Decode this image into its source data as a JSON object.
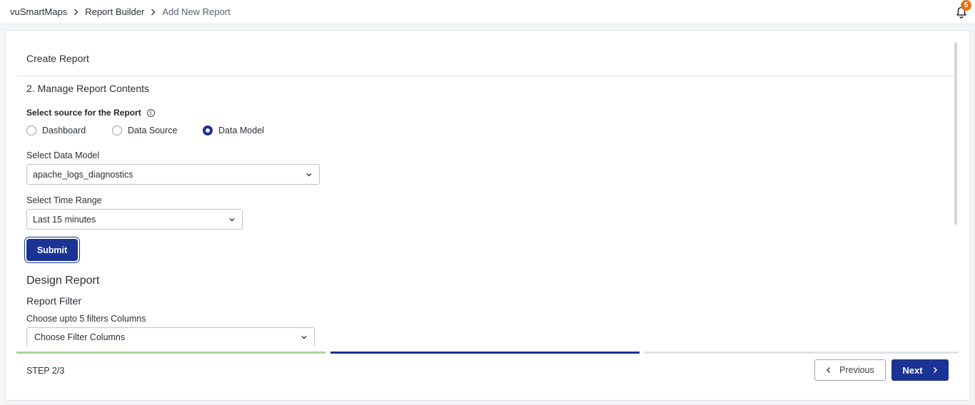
{
  "breadcrumb": {
    "items": [
      "vuSmartMaps",
      "Report Builder",
      "Add New Report"
    ]
  },
  "notifications": {
    "count": "5"
  },
  "header": {
    "title": "Create Report"
  },
  "step": {
    "title": "2. Manage Report Contents",
    "source_label": "Select source for the Report",
    "info_icon": "i",
    "sources": [
      {
        "label": "Dashboard",
        "selected": false
      },
      {
        "label": "Data Source",
        "selected": false
      },
      {
        "label": "Data Model",
        "selected": true
      }
    ]
  },
  "data_model": {
    "label": "Select Data Model",
    "value": "apache_logs_diagnostics"
  },
  "time_range": {
    "label": "Select Time Range",
    "value": "Last 15 minutes"
  },
  "submit_label": "Submit",
  "design": {
    "title": "Design Report",
    "filter_title": "Report Filter",
    "filter_label": "Choose upto 5 filters Columns",
    "filter_placeholder": "Choose Filter Columns"
  },
  "progress": {
    "colors": [
      "#a8d5a0",
      "#1a3394",
      "#e0e2e6"
    ]
  },
  "footer": {
    "step_text": "STEP 2/3",
    "previous_label": "Previous",
    "next_label": "Next"
  },
  "colors": {
    "primary": "#1a3394",
    "badge": "#e8720c"
  }
}
